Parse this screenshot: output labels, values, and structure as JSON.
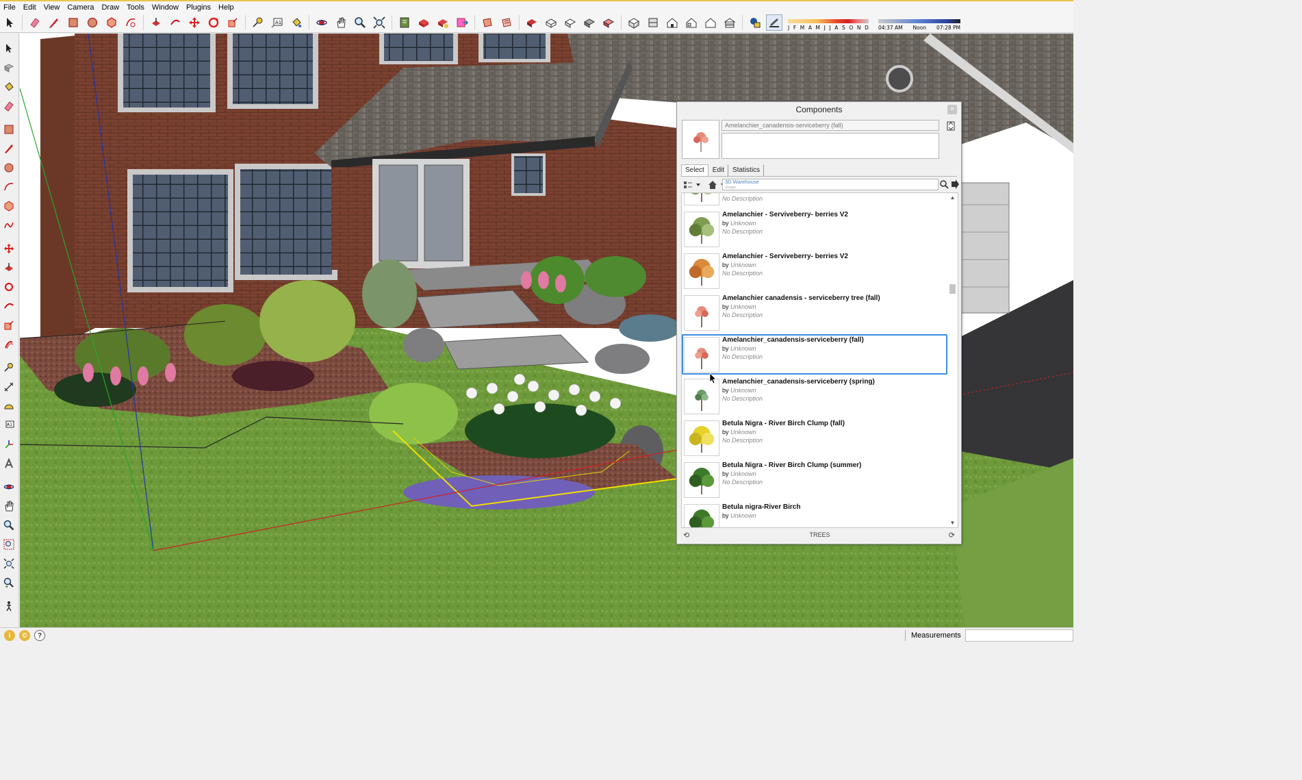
{
  "menu": [
    "File",
    "Edit",
    "View",
    "Camera",
    "Draw",
    "Tools",
    "Window",
    "Plugins",
    "Help"
  ],
  "shadow_settings": {
    "months": [
      "J",
      "F",
      "M",
      "A",
      "M",
      "J",
      "J",
      "A",
      "S",
      "O",
      "N",
      "D"
    ],
    "time_start": "04:37 AM",
    "time_mid": "Noon",
    "time_end": "07:28 PM"
  },
  "status_bar": {
    "measurements_label": "Measurements",
    "measurements_value": ""
  },
  "components_panel": {
    "title": "Components",
    "close_label": "×",
    "selected_name": "Amelanchier_canadensis-serviceberry (fall)",
    "selected_description": "",
    "tabs": [
      "Select",
      "Edit",
      "Statistics"
    ],
    "active_tab": "Select",
    "search_source": "3D Warehouse",
    "search_source_sub": "Google",
    "collection": "TREES",
    "items": [
      {
        "name": "",
        "author_prefix": "",
        "author": "",
        "description": "No Description",
        "thumb": "tree-green-light"
      },
      {
        "name": "Amelanchier  - Serviveberry- berries V2",
        "author_prefix": "by",
        "author": "Unknown",
        "description": "No Description",
        "thumb": "tree-green"
      },
      {
        "name": "Amelanchier  - Serviveberry- berries V2",
        "author_prefix": "by",
        "author": "Unknown",
        "description": "No Description",
        "thumb": "tree-orange"
      },
      {
        "name": "Amelanchier canadensis - serviceberry tree (fall)",
        "author_prefix": "by",
        "author": "Unknown",
        "description": "No Description",
        "thumb": "tree-red-small"
      },
      {
        "name": "Amelanchier_canadensis-serviceberry (fall)",
        "author_prefix": "by",
        "author": "Unknown",
        "description": "No Description",
        "thumb": "tree-red-small",
        "selected": true
      },
      {
        "name": "Amelanchier_canadensis-serviceberry (spring)",
        "author_prefix": "by",
        "author": "Unknown",
        "description": "No Description",
        "thumb": "tree-green-small"
      },
      {
        "name": "Betula Nigra - River Birch Clump (fall)",
        "author_prefix": "by",
        "author": "Unknown",
        "description": "No Description",
        "thumb": "tree-yellow"
      },
      {
        "name": "Betula Nigra - River Birch Clump (summer)",
        "author_prefix": "by",
        "author": "Unknown",
        "description": "No Description",
        "thumb": "tree-green-dark"
      },
      {
        "name": "Betula nigra-River Birch",
        "author_prefix": "by",
        "author": "Unknown",
        "description": "",
        "thumb": "tree-green-dark"
      }
    ]
  },
  "colors": {
    "accent_selection": "#3c8ee2",
    "grass": "#6e9a3c",
    "brick": "#7a4130",
    "roof": "#6f6a63"
  }
}
